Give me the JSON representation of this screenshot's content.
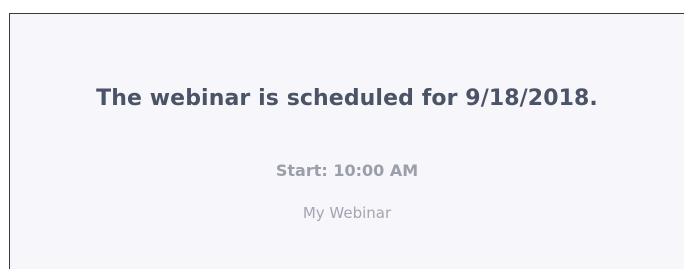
{
  "confirmation": {
    "headline": "The webinar is scheduled for 9/18/2018.",
    "start_time": "Start: 10:00 AM",
    "webinar_name": "My Webinar"
  },
  "colors": {
    "panel_background": "#f7f6fb",
    "headline_text": "#4b5467",
    "secondary_text": "#9b9faa"
  }
}
